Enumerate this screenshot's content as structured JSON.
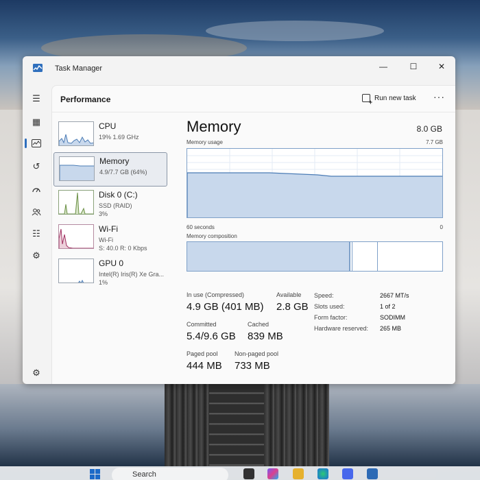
{
  "window": {
    "title": "Task Manager",
    "controls": {
      "minimize": "—",
      "maximize": "☐",
      "close": "✕"
    }
  },
  "header": {
    "title": "Performance",
    "run_new_task": "Run new task",
    "more": "···"
  },
  "rail": [
    {
      "icon": "hamburger-menu-icon",
      "glyph": "☰"
    },
    {
      "icon": "processes-icon",
      "glyph": "▦"
    },
    {
      "icon": "performance-icon",
      "glyph": "📈"
    },
    {
      "icon": "app-history-icon",
      "glyph": "↺"
    },
    {
      "icon": "startup-apps-icon",
      "glyph": "⚡"
    },
    {
      "icon": "users-icon",
      "glyph": "👥"
    },
    {
      "icon": "details-icon",
      "glyph": "☷"
    },
    {
      "icon": "services-icon",
      "glyph": "⚙"
    }
  ],
  "settings_glyph": "⚙",
  "resources": [
    {
      "name": "CPU",
      "sub": "19%  1.69 GHz",
      "sub2": ""
    },
    {
      "name": "Memory",
      "sub": "4.9/7.7 GB (64%)",
      "sub2": ""
    },
    {
      "name": "Disk 0 (C:)",
      "sub": "SSD (RAID)",
      "sub2": "3%"
    },
    {
      "name": "Wi-Fi",
      "sub": "Wi-Fi",
      "sub2": "S: 40.0  R: 0 Kbps"
    },
    {
      "name": "GPU 0",
      "sub": "Intel(R) Iris(R) Xe Gra...",
      "sub2": "1%"
    }
  ],
  "memory": {
    "title": "Memory",
    "total": "8.0 GB",
    "usage_label": "Memory usage",
    "usage_max": "7.7 GB",
    "time_left": "60 seconds",
    "time_right": "0",
    "composition_label": "Memory composition",
    "usage_fraction": 0.64,
    "composition": {
      "in_use": 0.635,
      "modified": 0.01,
      "standby": 0.1
    },
    "stats": {
      "in_use_label": "In use (Compressed)",
      "in_use_value": "4.9 GB (401 MB)",
      "available_label": "Available",
      "available_value": "2.8 GB",
      "committed_label": "Committed",
      "committed_value": "5.4/9.6 GB",
      "cached_label": "Cached",
      "cached_value": "839 MB",
      "paged_label": "Paged pool",
      "paged_value": "444 MB",
      "nonpaged_label": "Non-paged pool",
      "nonpaged_value": "733 MB"
    },
    "details": {
      "speed_label": "Speed:",
      "speed_value": "2667 MT/s",
      "slots_label": "Slots used:",
      "slots_value": "1 of 2",
      "form_label": "Form factor:",
      "form_value": "SODIMM",
      "hw_label": "Hardware reserved:",
      "hw_value": "265 MB"
    }
  },
  "taskbar": {
    "search": "Search"
  },
  "colors": {
    "accent": "#2f6fbd",
    "memory_fill": "#c8d8ec",
    "memory_line": "#7ea0c8"
  }
}
